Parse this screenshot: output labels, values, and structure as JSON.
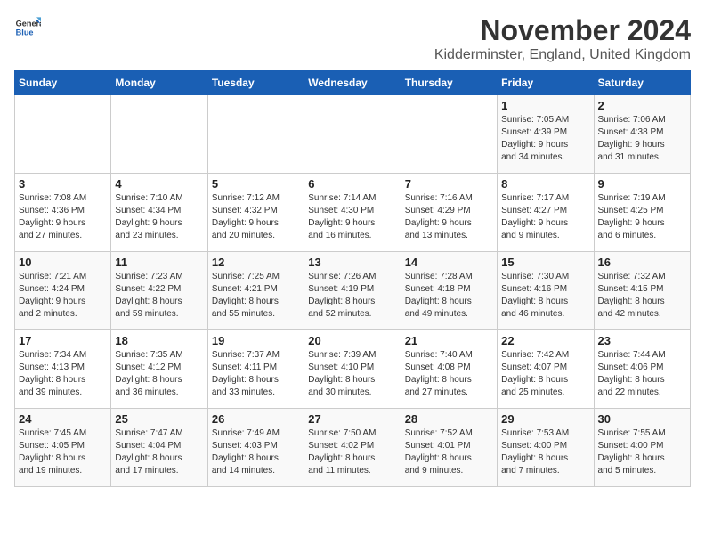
{
  "header": {
    "logo_general": "General",
    "logo_blue": "Blue",
    "month_title": "November 2024",
    "location": "Kidderminster, England, United Kingdom"
  },
  "weekdays": [
    "Sunday",
    "Monday",
    "Tuesday",
    "Wednesday",
    "Thursday",
    "Friday",
    "Saturday"
  ],
  "weeks": [
    [
      {
        "day": "",
        "info": ""
      },
      {
        "day": "",
        "info": ""
      },
      {
        "day": "",
        "info": ""
      },
      {
        "day": "",
        "info": ""
      },
      {
        "day": "",
        "info": ""
      },
      {
        "day": "1",
        "info": "Sunrise: 7:05 AM\nSunset: 4:39 PM\nDaylight: 9 hours\nand 34 minutes."
      },
      {
        "day": "2",
        "info": "Sunrise: 7:06 AM\nSunset: 4:38 PM\nDaylight: 9 hours\nand 31 minutes."
      }
    ],
    [
      {
        "day": "3",
        "info": "Sunrise: 7:08 AM\nSunset: 4:36 PM\nDaylight: 9 hours\nand 27 minutes."
      },
      {
        "day": "4",
        "info": "Sunrise: 7:10 AM\nSunset: 4:34 PM\nDaylight: 9 hours\nand 23 minutes."
      },
      {
        "day": "5",
        "info": "Sunrise: 7:12 AM\nSunset: 4:32 PM\nDaylight: 9 hours\nand 20 minutes."
      },
      {
        "day": "6",
        "info": "Sunrise: 7:14 AM\nSunset: 4:30 PM\nDaylight: 9 hours\nand 16 minutes."
      },
      {
        "day": "7",
        "info": "Sunrise: 7:16 AM\nSunset: 4:29 PM\nDaylight: 9 hours\nand 13 minutes."
      },
      {
        "day": "8",
        "info": "Sunrise: 7:17 AM\nSunset: 4:27 PM\nDaylight: 9 hours\nand 9 minutes."
      },
      {
        "day": "9",
        "info": "Sunrise: 7:19 AM\nSunset: 4:25 PM\nDaylight: 9 hours\nand 6 minutes."
      }
    ],
    [
      {
        "day": "10",
        "info": "Sunrise: 7:21 AM\nSunset: 4:24 PM\nDaylight: 9 hours\nand 2 minutes."
      },
      {
        "day": "11",
        "info": "Sunrise: 7:23 AM\nSunset: 4:22 PM\nDaylight: 8 hours\nand 59 minutes."
      },
      {
        "day": "12",
        "info": "Sunrise: 7:25 AM\nSunset: 4:21 PM\nDaylight: 8 hours\nand 55 minutes."
      },
      {
        "day": "13",
        "info": "Sunrise: 7:26 AM\nSunset: 4:19 PM\nDaylight: 8 hours\nand 52 minutes."
      },
      {
        "day": "14",
        "info": "Sunrise: 7:28 AM\nSunset: 4:18 PM\nDaylight: 8 hours\nand 49 minutes."
      },
      {
        "day": "15",
        "info": "Sunrise: 7:30 AM\nSunset: 4:16 PM\nDaylight: 8 hours\nand 46 minutes."
      },
      {
        "day": "16",
        "info": "Sunrise: 7:32 AM\nSunset: 4:15 PM\nDaylight: 8 hours\nand 42 minutes."
      }
    ],
    [
      {
        "day": "17",
        "info": "Sunrise: 7:34 AM\nSunset: 4:13 PM\nDaylight: 8 hours\nand 39 minutes."
      },
      {
        "day": "18",
        "info": "Sunrise: 7:35 AM\nSunset: 4:12 PM\nDaylight: 8 hours\nand 36 minutes."
      },
      {
        "day": "19",
        "info": "Sunrise: 7:37 AM\nSunset: 4:11 PM\nDaylight: 8 hours\nand 33 minutes."
      },
      {
        "day": "20",
        "info": "Sunrise: 7:39 AM\nSunset: 4:10 PM\nDaylight: 8 hours\nand 30 minutes."
      },
      {
        "day": "21",
        "info": "Sunrise: 7:40 AM\nSunset: 4:08 PM\nDaylight: 8 hours\nand 27 minutes."
      },
      {
        "day": "22",
        "info": "Sunrise: 7:42 AM\nSunset: 4:07 PM\nDaylight: 8 hours\nand 25 minutes."
      },
      {
        "day": "23",
        "info": "Sunrise: 7:44 AM\nSunset: 4:06 PM\nDaylight: 8 hours\nand 22 minutes."
      }
    ],
    [
      {
        "day": "24",
        "info": "Sunrise: 7:45 AM\nSunset: 4:05 PM\nDaylight: 8 hours\nand 19 minutes."
      },
      {
        "day": "25",
        "info": "Sunrise: 7:47 AM\nSunset: 4:04 PM\nDaylight: 8 hours\nand 17 minutes."
      },
      {
        "day": "26",
        "info": "Sunrise: 7:49 AM\nSunset: 4:03 PM\nDaylight: 8 hours\nand 14 minutes."
      },
      {
        "day": "27",
        "info": "Sunrise: 7:50 AM\nSunset: 4:02 PM\nDaylight: 8 hours\nand 11 minutes."
      },
      {
        "day": "28",
        "info": "Sunrise: 7:52 AM\nSunset: 4:01 PM\nDaylight: 8 hours\nand 9 minutes."
      },
      {
        "day": "29",
        "info": "Sunrise: 7:53 AM\nSunset: 4:00 PM\nDaylight: 8 hours\nand 7 minutes."
      },
      {
        "day": "30",
        "info": "Sunrise: 7:55 AM\nSunset: 4:00 PM\nDaylight: 8 hours\nand 5 minutes."
      }
    ]
  ]
}
